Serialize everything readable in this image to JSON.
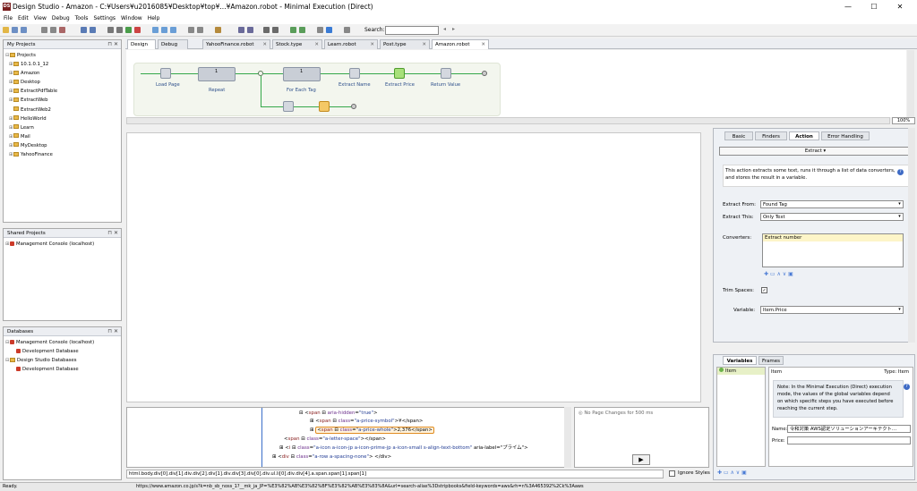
{
  "window": {
    "title": "Design Studio - Amazon - C:¥Users¥u2016085¥Desktop¥top¥...¥Amazon.robot - Minimal Execution (Direct)",
    "app_icon": "DS"
  },
  "menu": [
    "File",
    "Edit",
    "View",
    "Debug",
    "Tools",
    "Settings",
    "Window",
    "Help"
  ],
  "toolbar": {
    "search_label": "Search:",
    "search_value": ""
  },
  "my_projects": {
    "title": "My Projects",
    "items": [
      "Projects",
      "10.1.0.1_12",
      "Amazon",
      "Desktop",
      "ExtractPdfTable",
      "ExtractWeb",
      "ExtractWeb2",
      "HelloWorld",
      "Learn",
      "Mail",
      "MyDesktop",
      "YahooFinance"
    ]
  },
  "shared_projects": {
    "title": "Shared Projects",
    "items": [
      "Management Console (localhost)"
    ]
  },
  "databases": {
    "title": "Databases",
    "items": [
      "Management Console (localhost)",
      "Development Database",
      "Design Studio Databases",
      "Development Database"
    ]
  },
  "mode_buttons": {
    "design": "Design",
    "debug": "Debug"
  },
  "tabs": [
    "YahooFinance.robot",
    "Stock.type",
    "Learn.robot",
    "Post.type",
    "Amazon.robot"
  ],
  "flow": {
    "steps": [
      "Load Page",
      "Repeat",
      "For Each Tag",
      "Extract Name",
      "Extract Price",
      "Return Value"
    ],
    "zoom": "100%",
    "repeat_badge": "1",
    "foreach_badge": "1"
  },
  "right_panel": {
    "tabs": [
      "Basic",
      "Finders",
      "Action",
      "Error Handling"
    ],
    "action_select": "Extract",
    "description": "This action extracts some text, runs it through a list of data converters, and stores the result in a variable.",
    "extract_from_label": "Extract From:",
    "extract_from_value": "Found Tag",
    "extract_this_label": "Extract This:",
    "extract_this_value": "Only Text",
    "converters_label": "Converters:",
    "converter_item": "Extract number",
    "trim_label": "Trim Spaces:",
    "variable_label": "Variable:",
    "variable_value": "Item.Price"
  },
  "variables_panel": {
    "tabs": [
      "Variables",
      "Frames"
    ],
    "var_item": "Item",
    "detail_name": "Item",
    "detail_type": "Type: Item",
    "note": "Note: In the Minimal Execution (Direct) execution mode, the values of the global variables depend on which specific steps you have executed before reaching the current step.",
    "name_label": "Name:",
    "name_value": "令和対策 AWS認定ソリューションアーキテクト…",
    "price_label": "Price:",
    "price_value": ""
  },
  "html_view": {
    "lines": [
      {
        "tag": "span",
        "attr": "aria-hidden",
        "val": "\"true\"",
        "tail": ">"
      },
      {
        "tag": "span",
        "attr": "class",
        "val": "\"a-price-symbol\"",
        "tail": ">¥</span>"
      },
      {
        "tag": "span",
        "attr": "class",
        "val": "\"a-price-whole\"",
        "tail": ">2,376</span>"
      },
      {
        "tag": "span",
        "attr": "class",
        "val": "\"a-letter-space\"",
        "tail": "></span>"
      },
      {
        "tag": "i",
        "attr": "class",
        "val": "\"a-icon a-icon-jp a-icon-prime-jp a-icon-small s-align-text-bottom\"",
        "tail": " aria-label=\"プライム\">"
      },
      {
        "tag": "div",
        "attr": "class",
        "val": "\"a-row a-spacing-none\"",
        "tail": ">  </div>"
      }
    ]
  },
  "page_changes": "No Page Changes for 500 ms",
  "breadcrumb_path": "html.body.div[0].div[1].div.div[2].div[1].div.div[3].div[0].div.ul.li[0].div.div[4].a.span.span[1].span[1]",
  "ignore_styles": "Ignore Styles",
  "status": {
    "left": "Ready.",
    "url": "https://www.amazon.co.jp/s?k=nb_sb_noss_1?__mk_ja_JP=%E3%82%AB%E3%82%BF%E3%82%AB%E3%83%8A&url=search-alias%3Dstripbooks&field-keywords=aws&rh=n%3A465392%2Ck%3Aaws"
  }
}
